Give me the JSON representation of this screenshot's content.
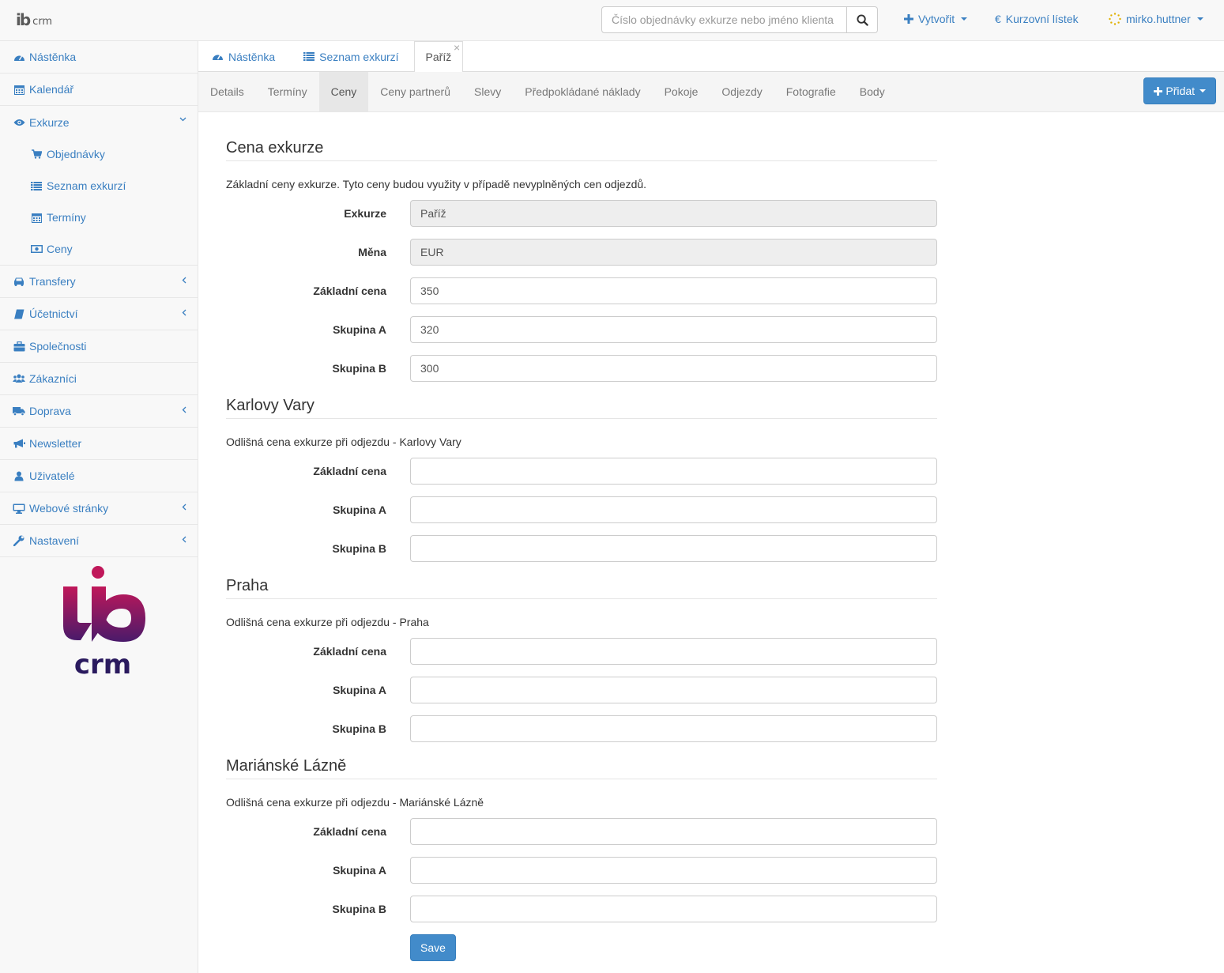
{
  "navbar": {
    "logo_mark": "ib",
    "logo_text": "crm",
    "search_placeholder": "Číslo objednávky exkurze nebo jméno klienta",
    "create_label": "Vytvořit",
    "exchange_label": "Kurzovní lístek",
    "user_label": "mirko.huttner",
    "accent_color": "#3a7fc1"
  },
  "sidebar": {
    "items": [
      {
        "label": "Nástěnka",
        "icon": "dashboard-icon"
      },
      {
        "label": "Kalendář",
        "icon": "calendar-icon"
      },
      {
        "label": "Exkurze",
        "icon": "eye-icon"
      },
      {
        "label": "Transfery",
        "icon": "car-icon"
      },
      {
        "label": "Účetnictví",
        "icon": "book-icon"
      },
      {
        "label": "Společnosti",
        "icon": "briefcase-icon"
      },
      {
        "label": "Zákazníci",
        "icon": "users-icon"
      },
      {
        "label": "Doprava",
        "icon": "truck-icon"
      },
      {
        "label": "Newsletter",
        "icon": "bullhorn-icon"
      },
      {
        "label": "Uživatelé",
        "icon": "user-icon"
      },
      {
        "label": "Webové stránky",
        "icon": "desktop-icon"
      },
      {
        "label": "Nastavení",
        "icon": "wrench-icon"
      }
    ],
    "sub_items": [
      {
        "label": "Objednávky",
        "icon": "cart-icon"
      },
      {
        "label": "Seznam exkurzí",
        "icon": "list-icon"
      },
      {
        "label": "Termíny",
        "icon": "calendar-icon"
      },
      {
        "label": "Ceny",
        "icon": "money-icon"
      }
    ],
    "big_logo_text": "crm"
  },
  "tabs": [
    {
      "label": "Nástěnka"
    },
    {
      "label": "Seznam exkurzí"
    },
    {
      "label": "Paříž"
    }
  ],
  "subtabs": [
    "Details",
    "Termíny",
    "Ceny",
    "Ceny partnerů",
    "Slevy",
    "Předpokládané náklady",
    "Pokoje",
    "Odjezdy",
    "Fotografie",
    "Body"
  ],
  "add_button": "Přidat",
  "sections": [
    {
      "title": "Cena exkurze",
      "desc": "Základní ceny exkurze. Tyto ceny budou využity v případě nevyplněných cen odjezdů.",
      "fields": [
        {
          "label": "Exkurze",
          "value": "Paříž",
          "readonly": true
        },
        {
          "label": "Měna",
          "value": "EUR",
          "readonly": true
        },
        {
          "label": "Základní cena",
          "value": "350"
        },
        {
          "label": "Skupina A",
          "value": "320"
        },
        {
          "label": "Skupina B",
          "value": "300"
        }
      ]
    },
    {
      "title": "Karlovy Vary",
      "desc": "Odlišná cena exkurze při odjezdu - Karlovy Vary",
      "fields": [
        {
          "label": "Základní cena",
          "value": ""
        },
        {
          "label": "Skupina A",
          "value": ""
        },
        {
          "label": "Skupina B",
          "value": ""
        }
      ]
    },
    {
      "title": "Praha",
      "desc": "Odlišná cena exkurze při odjezdu - Praha",
      "fields": [
        {
          "label": "Základní cena",
          "value": ""
        },
        {
          "label": "Skupina A",
          "value": ""
        },
        {
          "label": "Skupina B",
          "value": ""
        }
      ]
    },
    {
      "title": "Mariánské Lázně",
      "desc": "Odlišná cena exkurze při odjezdu - Mariánské Lázně",
      "fields": [
        {
          "label": "Základní cena",
          "value": ""
        },
        {
          "label": "Skupina A",
          "value": ""
        },
        {
          "label": "Skupina B",
          "value": ""
        }
      ]
    }
  ],
  "save_label": "Save"
}
